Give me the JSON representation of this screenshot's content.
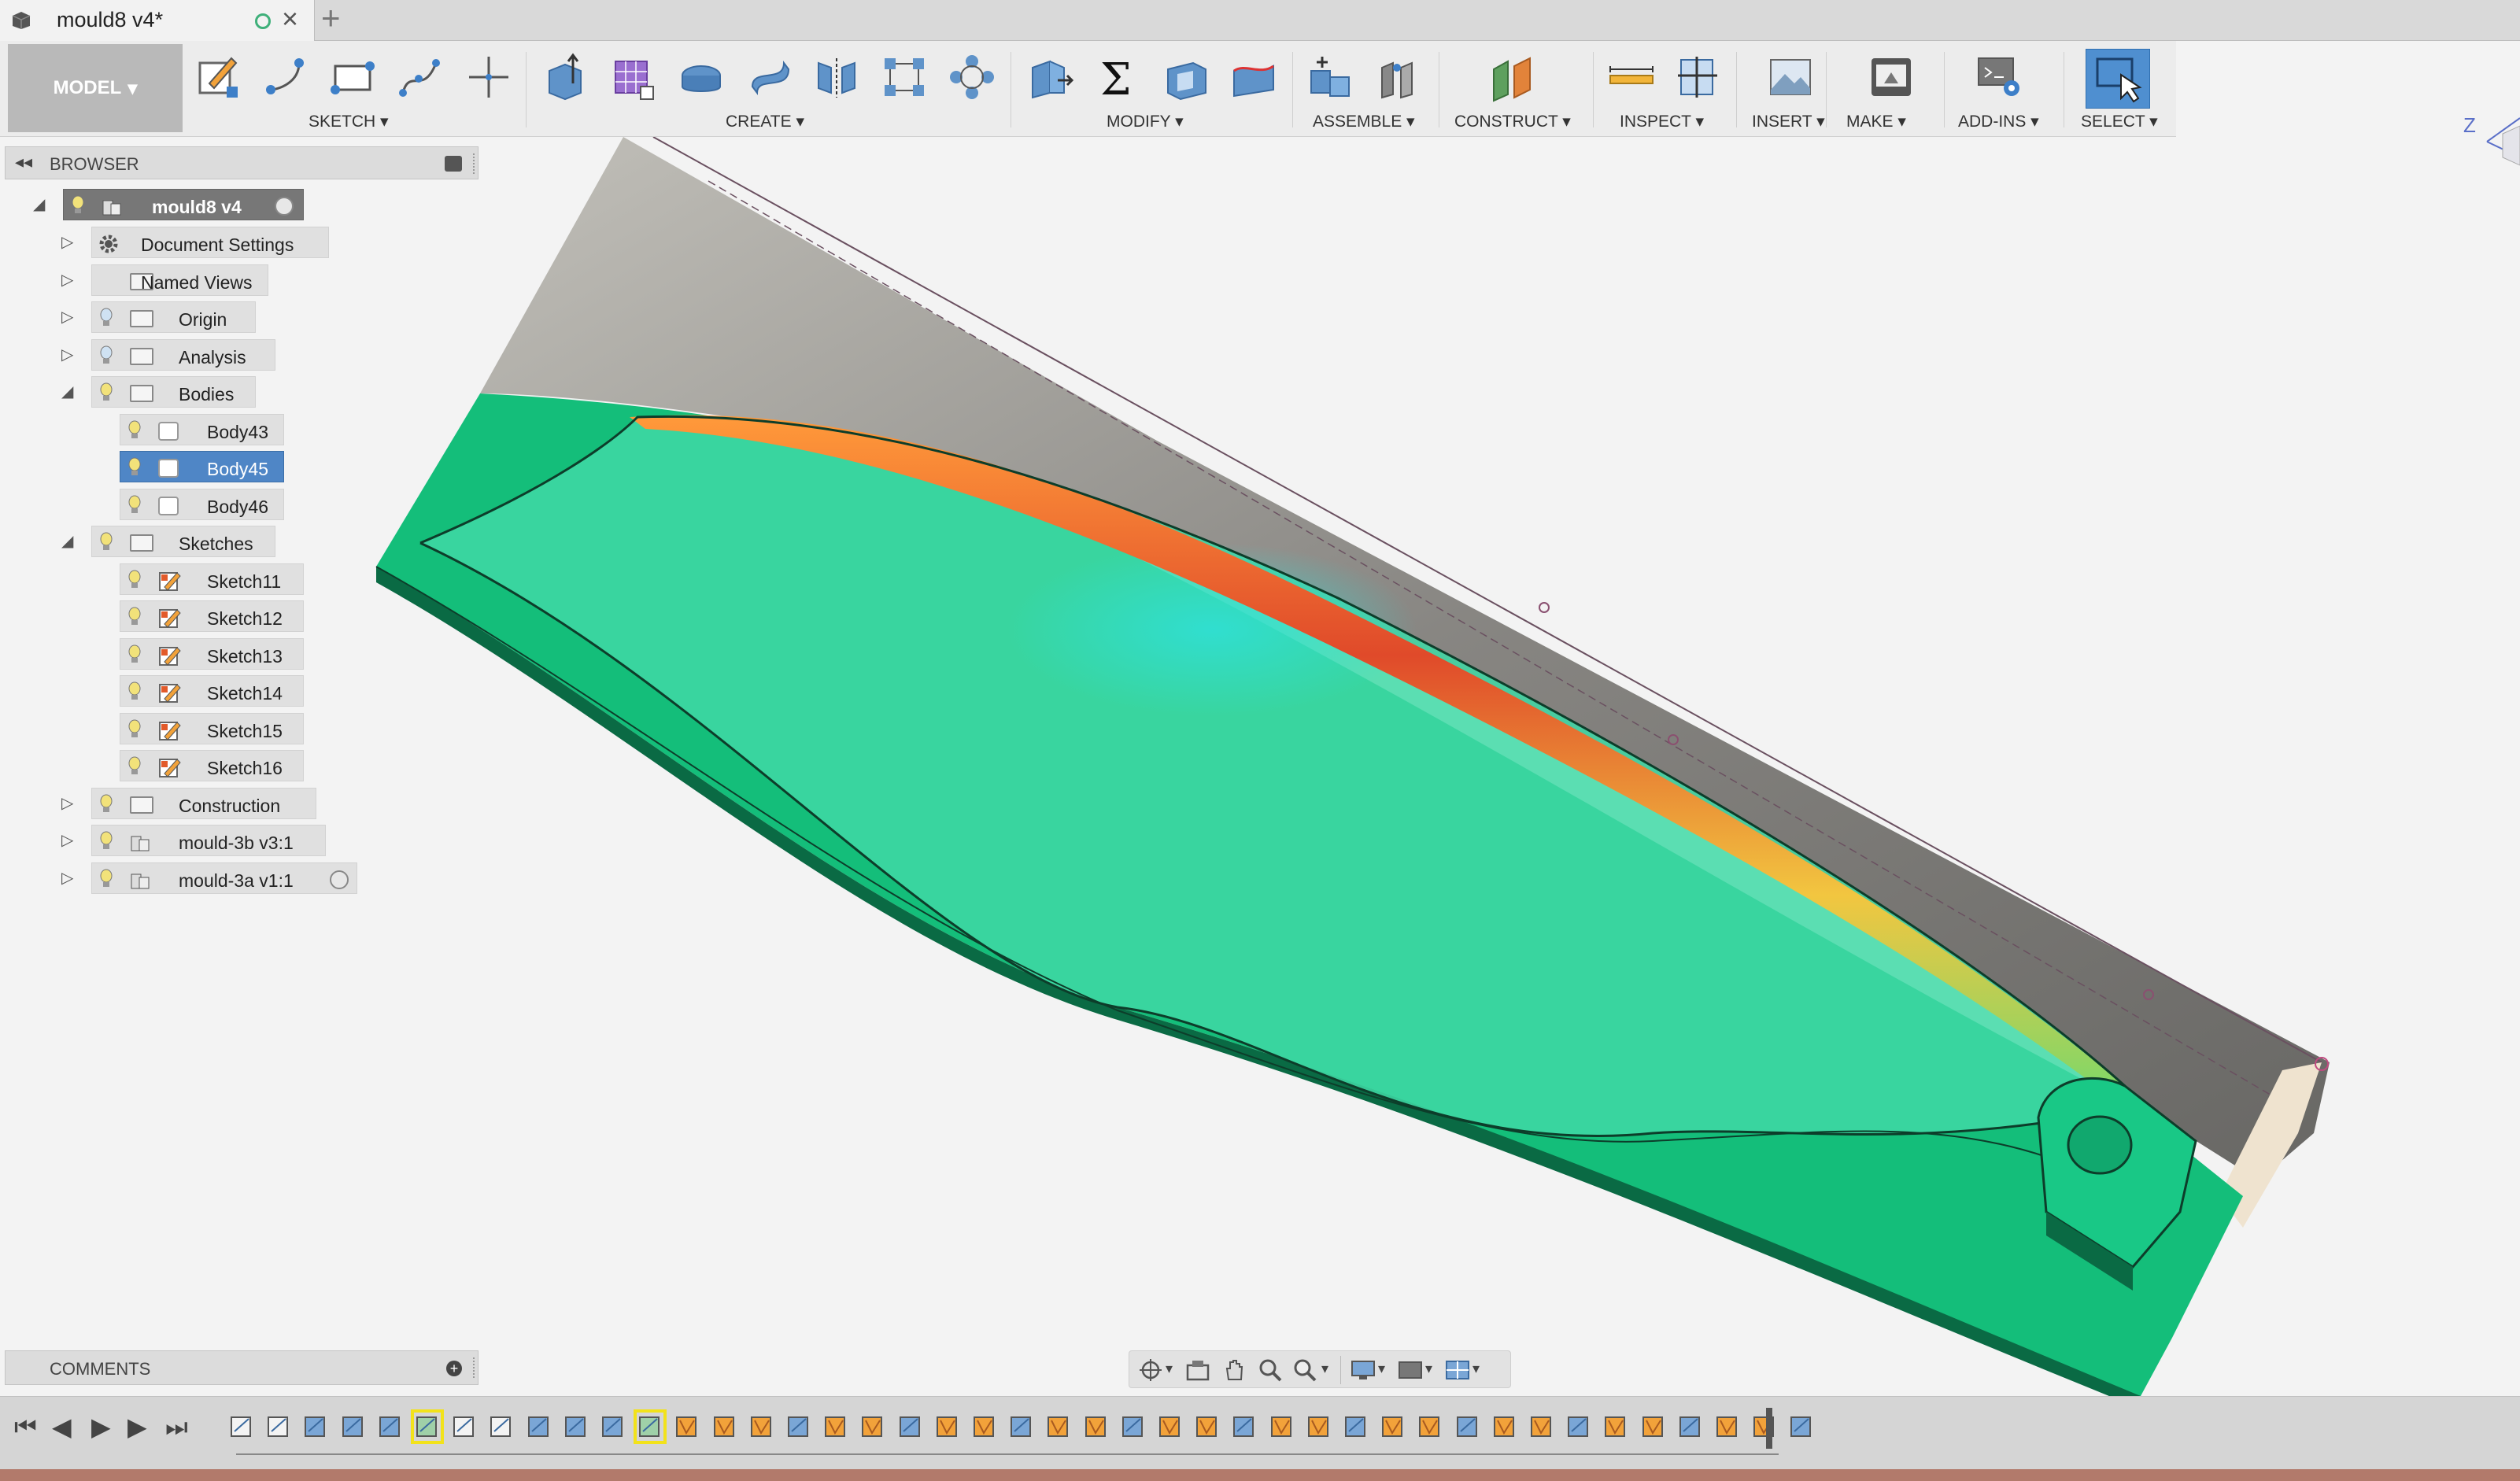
{
  "app": {
    "tab_title": "mould8 v4*",
    "tab_close": "×",
    "new_tab": "+"
  },
  "toolbar": {
    "model_label": "MODEL",
    "groups": [
      {
        "name": "sketch",
        "label": "SKETCH ▾"
      },
      {
        "name": "create",
        "label": "CREATE ▾"
      },
      {
        "name": "modify",
        "label": "MODIFY ▾"
      },
      {
        "name": "assemble",
        "label": "ASSEMBLE ▾"
      },
      {
        "name": "construct",
        "label": "CONSTRUCT ▾"
      },
      {
        "name": "inspect",
        "label": "INSPECT ▾"
      },
      {
        "name": "insert",
        "label": "INSERT ▾"
      },
      {
        "name": "make",
        "label": "MAKE ▾"
      },
      {
        "name": "addins",
        "label": "ADD-INS ▾"
      },
      {
        "name": "select",
        "label": "SELECT ▾"
      }
    ],
    "icons": {
      "sketch": [
        "create-sketch-icon",
        "arc-icon",
        "rectangle-icon",
        "spline-icon",
        "point-icon"
      ],
      "create": [
        "extrude-icon",
        "form-icon",
        "revolve-icon",
        "sweep-icon",
        "mirror-icon",
        "pattern-icon",
        "move-pattern-icon"
      ],
      "modify": [
        "press-pull-icon",
        "compute-sigma-icon",
        "shell-icon",
        "replace-face-icon"
      ],
      "assemble": [
        "new-component-icon",
        "joint-icon"
      ],
      "construct": [
        "offset-plane-icon"
      ],
      "inspect": [
        "measure-icon",
        "section-analysis-icon"
      ],
      "insert": [
        "insert-image-icon"
      ],
      "make": [
        "3d-print-icon"
      ],
      "addins": [
        "scripts-icon"
      ],
      "select": [
        "select-arrow-icon"
      ]
    },
    "select_color": "#4f8fd0"
  },
  "browser": {
    "title": "BROWSER",
    "collapse_glyph": "◂◂",
    "root_label": "mould8 v4",
    "items": [
      {
        "label": "Document Settings",
        "icon": "gear-icon",
        "bulb": false,
        "arrow": "▷"
      },
      {
        "label": "Named Views",
        "icon": "folder-icon",
        "bulb": false,
        "arrow": "▷"
      },
      {
        "label": "Origin",
        "icon": "folder-icon",
        "bulb": true,
        "arrow": "▷"
      },
      {
        "label": "Analysis",
        "icon": "folder-icon",
        "bulb": true,
        "arrow": "▷"
      },
      {
        "label": "Bodies",
        "icon": "folder-icon",
        "bulb": true,
        "arrow": "◢"
      },
      {
        "label": "Body43",
        "icon": "body-icon",
        "bulb": true,
        "arrow": ""
      },
      {
        "label": "Body45",
        "icon": "body-icon",
        "bulb": true,
        "arrow": "",
        "selected": true
      },
      {
        "label": "Body46",
        "icon": "body-icon",
        "bulb": true,
        "arrow": ""
      },
      {
        "label": "Sketches",
        "icon": "folder-icon",
        "bulb": true,
        "arrow": "◢"
      },
      {
        "label": "Sketch11",
        "icon": "sketch-icon",
        "bulb": true,
        "arrow": ""
      },
      {
        "label": "Sketch12",
        "icon": "sketch-icon",
        "bulb": true,
        "arrow": ""
      },
      {
        "label": "Sketch13",
        "icon": "sketch-icon",
        "bulb": true,
        "arrow": ""
      },
      {
        "label": "Sketch14",
        "icon": "sketch-icon",
        "bulb": true,
        "arrow": ""
      },
      {
        "label": "Sketch15",
        "icon": "sketch-icon",
        "bulb": true,
        "arrow": ""
      },
      {
        "label": "Sketch16",
        "icon": "sketch-icon",
        "bulb": true,
        "arrow": ""
      },
      {
        "label": "Construction",
        "icon": "folder-icon",
        "bulb": true,
        "arrow": "▷"
      },
      {
        "label": "mould-3b v3:1",
        "icon": "component-icon",
        "bulb": true,
        "arrow": "▷"
      },
      {
        "label": "mould-3a v1:1",
        "icon": "component-icon",
        "bulb": true,
        "arrow": "▷",
        "radio": true
      }
    ]
  },
  "comments": {
    "title": "COMMENTS",
    "add_glyph": "+"
  },
  "viewcube": {
    "axis_label": "Z"
  },
  "timeline": {
    "controls": [
      "⏮",
      "◀",
      "▶",
      "▶",
      "⏭"
    ],
    "feature_count": 43,
    "highlighted": [
      5,
      11
    ]
  },
  "colors": {
    "body_green": "#19c27e",
    "highlight_yellow": "#f2e21a",
    "selection_blue": "#4f86c6"
  }
}
